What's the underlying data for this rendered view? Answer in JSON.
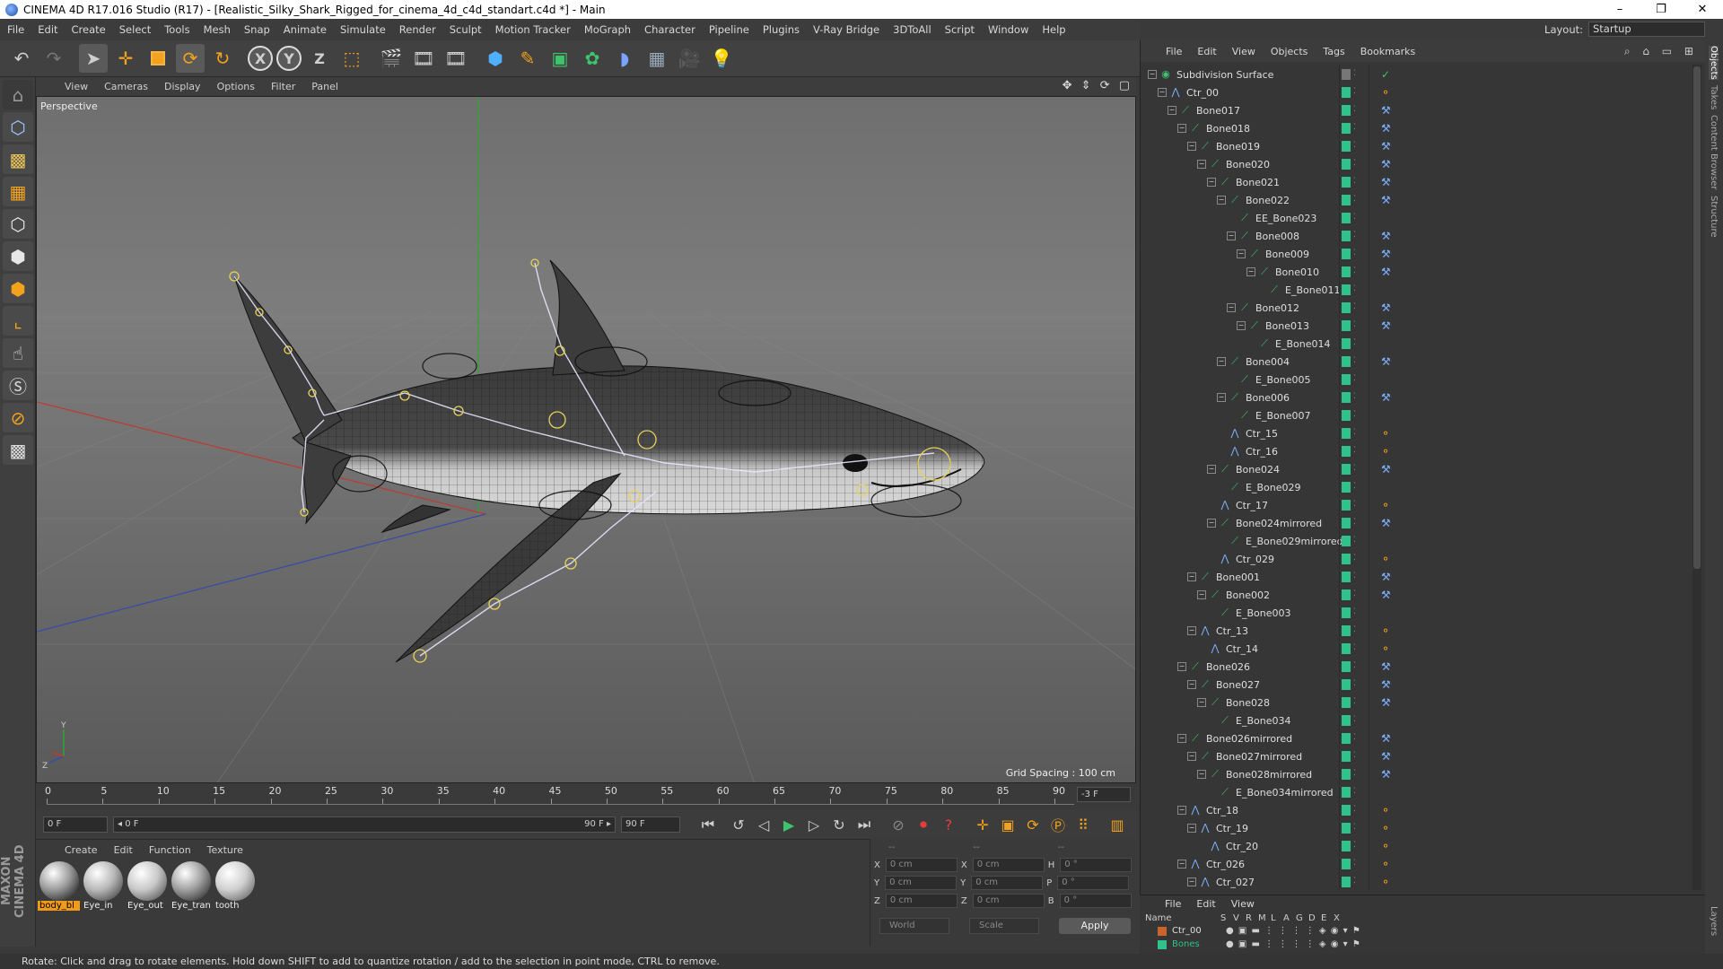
{
  "window": {
    "title": "CINEMA 4D R17.016 Studio (R17) - [Realistic_Silky_Shark_Rigged_for_cinema_4d_c4d_standart.c4d *] - Main",
    "minimize": "–",
    "maximize": "❐",
    "close": "✕"
  },
  "menubar": [
    "File",
    "Edit",
    "Create",
    "Select",
    "Tools",
    "Mesh",
    "Snap",
    "Animate",
    "Simulate",
    "Render",
    "Sculpt",
    "Motion Tracker",
    "MoGraph",
    "Character",
    "Pipeline",
    "Plugins",
    "V-Ray Bridge",
    "3DToAll",
    "Script",
    "Window",
    "Help"
  ],
  "layout": {
    "label": "Layout:",
    "value": "Startup"
  },
  "toolbar": {
    "icons": [
      "undo-icon",
      "redo-icon",
      "select-arrow-icon",
      "move-icon",
      "scale-icon",
      "rotate-icon",
      "recent-tool-icon",
      "x-axis-icon",
      "y-axis-icon",
      "z-axis-icon",
      "world-coords-icon",
      "render-view-icon",
      "render-picture-queue-icon",
      "render-settings-icon",
      "cube-primitive-icon",
      "spline-pen-icon",
      "subdivision-icon",
      "array-icon",
      "deformer-icon",
      "floor-icon",
      "camera-icon",
      "light-icon"
    ],
    "axis_x": "X",
    "axis_y": "Y",
    "axis_z": "Z"
  },
  "left_tools": [
    "model-mode-icon",
    "texture-mode-icon",
    "workplane-icon",
    "points-mode-icon",
    "edges-mode-icon",
    "polygons-mode-icon",
    "uvw-icon",
    "move-tool-icon",
    "snap-icon",
    "magnet-icon",
    "grid-snap-icon",
    "lock-icon"
  ],
  "maxon_logo": "MAXON CINEMA 4D",
  "viewport": {
    "menu": [
      "View",
      "Cameras",
      "Display",
      "Options",
      "Filter",
      "Panel"
    ],
    "nav_icons": "✥ ⇕ ⟳ ▢",
    "camera_label": "Perspective",
    "grid_spacing": "Grid Spacing : 100 cm",
    "axis_y_label": "Y",
    "axis_z_label": "Z"
  },
  "timeline": {
    "ticks": [
      "0",
      "5",
      "10",
      "15",
      "20",
      "25",
      "30",
      "35",
      "40",
      "45",
      "50",
      "55",
      "60",
      "65",
      "70",
      "75",
      "80",
      "85",
      "90"
    ],
    "current_frame": "-3 F",
    "start_field": "0 F",
    "range_start": "◂ 0 F",
    "range_end": "90 F ▸",
    "end_field": "90 F"
  },
  "transport_icons": [
    "go-start-icon",
    "prev-key-icon",
    "prev-frame-icon",
    "play-icon",
    "next-frame-icon",
    "next-key-icon",
    "go-end-icon",
    "record-icon",
    "autokey-icon",
    "keyframe-selection-icon",
    "position-key-icon",
    "scale-key-icon",
    "rotation-key-icon",
    "param-key-icon",
    "pla-key-icon",
    "timeline-icon"
  ],
  "material_manager": {
    "menu": [
      "Create",
      "Edit",
      "Function",
      "Texture"
    ],
    "materials": [
      {
        "name": "body_bl",
        "selected": true
      },
      {
        "name": "Eye_in",
        "selected": false
      },
      {
        "name": "Eye_out",
        "selected": false
      },
      {
        "name": "Eye_tran",
        "selected": false
      },
      {
        "name": "tooth",
        "selected": false
      }
    ]
  },
  "coordinates": {
    "header_left": "--",
    "header_mid": "--",
    "header_right": "--",
    "rows": [
      {
        "a": "X",
        "av": "0 cm",
        "b": "X",
        "bv": "0 cm",
        "c": "H",
        "cv": "0 °"
      },
      {
        "a": "Y",
        "av": "0 cm",
        "b": "Y",
        "bv": "0 cm",
        "c": "P",
        "cv": "0 °"
      },
      {
        "a": "Z",
        "av": "0 cm",
        "b": "Z",
        "bv": "0 cm",
        "c": "B",
        "cv": "0 °"
      }
    ],
    "space": "World",
    "mode": "Scale",
    "apply": "Apply"
  },
  "object_manager": {
    "menu": [
      "File",
      "Edit",
      "View",
      "Objects",
      "Tags",
      "Bookmarks"
    ],
    "icons": "⌕ ⌂ ▭ ⊞",
    "rows": [
      {
        "name": "Subdivision Surface",
        "depth": 0,
        "kind": "subdiv",
        "toggle": "−"
      },
      {
        "name": "Ctr_00",
        "depth": 1,
        "kind": "null",
        "toggle": "−"
      },
      {
        "name": "Bone017",
        "depth": 2,
        "kind": "bone",
        "toggle": "−"
      },
      {
        "name": "Bone018",
        "depth": 3,
        "kind": "bone",
        "toggle": "−"
      },
      {
        "name": "Bone019",
        "depth": 4,
        "kind": "bone",
        "toggle": "−"
      },
      {
        "name": "Bone020",
        "depth": 5,
        "kind": "bone",
        "toggle": "−"
      },
      {
        "name": "Bone021",
        "depth": 6,
        "kind": "bone",
        "toggle": "−"
      },
      {
        "name": "Bone022",
        "depth": 7,
        "kind": "bone",
        "toggle": "−"
      },
      {
        "name": "EE_Bone023",
        "depth": 8,
        "kind": "bone",
        "toggle": ""
      },
      {
        "name": "Bone008",
        "depth": 8,
        "kind": "bone",
        "toggle": "−"
      },
      {
        "name": "Bone009",
        "depth": 9,
        "kind": "bone",
        "toggle": "−"
      },
      {
        "name": "Bone010",
        "depth": 10,
        "kind": "bone",
        "toggle": "−"
      },
      {
        "name": "E_Bone011",
        "depth": 11,
        "kind": "bone",
        "toggle": ""
      },
      {
        "name": "Bone012",
        "depth": 8,
        "kind": "bone",
        "toggle": "−"
      },
      {
        "name": "Bone013",
        "depth": 9,
        "kind": "bone",
        "toggle": "−"
      },
      {
        "name": "E_Bone014",
        "depth": 10,
        "kind": "bone",
        "toggle": ""
      },
      {
        "name": "Bone004",
        "depth": 7,
        "kind": "bone",
        "toggle": "−"
      },
      {
        "name": "E_Bone005",
        "depth": 8,
        "kind": "bone",
        "toggle": ""
      },
      {
        "name": "Bone006",
        "depth": 7,
        "kind": "bone",
        "toggle": "−"
      },
      {
        "name": "E_Bone007",
        "depth": 8,
        "kind": "bone",
        "toggle": ""
      },
      {
        "name": "Ctr_15",
        "depth": 7,
        "kind": "null",
        "toggle": ""
      },
      {
        "name": "Ctr_16",
        "depth": 7,
        "kind": "null",
        "toggle": ""
      },
      {
        "name": "Bone024",
        "depth": 6,
        "kind": "bone",
        "toggle": "−"
      },
      {
        "name": "E_Bone029",
        "depth": 7,
        "kind": "bone",
        "toggle": ""
      },
      {
        "name": "Ctr_17",
        "depth": 6,
        "kind": "null",
        "toggle": ""
      },
      {
        "name": "Bone024mirrored",
        "depth": 6,
        "kind": "bone",
        "toggle": "−"
      },
      {
        "name": "E_Bone029mirrored",
        "depth": 7,
        "kind": "bone",
        "toggle": ""
      },
      {
        "name": "Ctr_029",
        "depth": 6,
        "kind": "null",
        "toggle": ""
      },
      {
        "name": "Bone001",
        "depth": 4,
        "kind": "bone",
        "toggle": "−"
      },
      {
        "name": "Bone002",
        "depth": 5,
        "kind": "bone",
        "toggle": "−"
      },
      {
        "name": "E_Bone003",
        "depth": 6,
        "kind": "bone",
        "toggle": ""
      },
      {
        "name": "Ctr_13",
        "depth": 4,
        "kind": "null",
        "toggle": "−"
      },
      {
        "name": "Ctr_14",
        "depth": 5,
        "kind": "null",
        "toggle": ""
      },
      {
        "name": "Bone026",
        "depth": 3,
        "kind": "bone",
        "toggle": "−"
      },
      {
        "name": "Bone027",
        "depth": 4,
        "kind": "bone",
        "toggle": "−"
      },
      {
        "name": "Bone028",
        "depth": 5,
        "kind": "bone",
        "toggle": "−"
      },
      {
        "name": "E_Bone034",
        "depth": 6,
        "kind": "bone",
        "toggle": ""
      },
      {
        "name": "Bone026mirrored",
        "depth": 3,
        "kind": "bone",
        "toggle": "−"
      },
      {
        "name": "Bone027mirrored",
        "depth": 4,
        "kind": "bone",
        "toggle": "−"
      },
      {
        "name": "Bone028mirrored",
        "depth": 5,
        "kind": "bone",
        "toggle": "−"
      },
      {
        "name": "E_Bone034mirrored",
        "depth": 6,
        "kind": "bone",
        "toggle": ""
      },
      {
        "name": "Ctr_18",
        "depth": 3,
        "kind": "null",
        "toggle": "−"
      },
      {
        "name": "Ctr_19",
        "depth": 4,
        "kind": "null",
        "toggle": "−"
      },
      {
        "name": "Ctr_20",
        "depth": 5,
        "kind": "null",
        "toggle": ""
      },
      {
        "name": "Ctr_026",
        "depth": 3,
        "kind": "null",
        "toggle": "−"
      },
      {
        "name": "Ctr_027",
        "depth": 4,
        "kind": "null",
        "toggle": "−"
      }
    ]
  },
  "right_tabs": [
    "Objects",
    "Takes",
    "Content Browser",
    "Structure"
  ],
  "layer_manager": {
    "menu": [
      "File",
      "Edit",
      "View"
    ],
    "columns": [
      "Name",
      "S",
      "V",
      "R",
      "M",
      "L",
      "A",
      "G",
      "D",
      "E",
      "X"
    ],
    "rows": [
      {
        "name": "Ctr_00",
        "color": "#c8642c"
      },
      {
        "name": "Bones",
        "color": "#2fc28a"
      }
    ],
    "layers_tab": "Layers"
  },
  "status": "Rotate: Click and drag to rotate elements. Hold down SHIFT to add to quantize rotation / add to the selection in point mode, CTRL to remove.",
  "colors": {
    "accent": "#f09a1a",
    "visible_green": "#2fc28a"
  }
}
